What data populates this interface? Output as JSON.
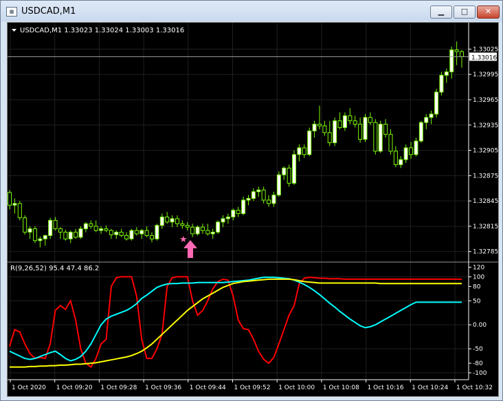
{
  "window": {
    "title": "USDCAD,M1",
    "icon": "chart-window-icon",
    "buttons": [
      "minimize",
      "maximize",
      "close"
    ]
  },
  "chart_header": {
    "symbol_info": "USDCAD,M1  1.33023 1.33024 1.33003 1.33016"
  },
  "price_axis": {
    "ticks": [
      "1.33025",
      "1.32995",
      "1.32965",
      "1.32935",
      "1.32905",
      "1.32875",
      "1.32845",
      "1.32815",
      "1.32785"
    ],
    "current_price": "1.33016"
  },
  "indicator": {
    "label": "R(9,26,52) 95.4 47.4 86.2",
    "axis_ticks": [
      "120",
      "100",
      "80",
      "50",
      "0.00",
      "-50",
      "-80",
      "-100"
    ]
  },
  "time_axis": {
    "ticks": [
      "1 Oct 2020",
      "1 Oct 09:20",
      "1 Oct 09:28",
      "1 Oct 09:36",
      "1 Oct 09:44",
      "1 Oct 09:52",
      "1 Oct 10:00",
      "1 Oct 10:08",
      "1 Oct 10:16",
      "1 Oct 10:24",
      "1 Oct 10:32"
    ]
  },
  "colors": {
    "background": "#000000",
    "candle_bull": "#ffffff",
    "candle_bear": "#000000",
    "candle_border": "#7cfc00",
    "bid_line": "#a0a0a0",
    "fast_line": "#ff0000",
    "medium_line": "#00ffff",
    "slow_line": "#ffff00",
    "arrow": "#ff69b4"
  },
  "chart_data": [
    {
      "type": "candlestick",
      "title": "USDCAD,M1",
      "ylim": [
        1.32775,
        1.3304
      ],
      "candles": [
        [
          1.32855,
          1.32858,
          1.32835,
          1.3284
        ],
        [
          1.3284,
          1.32848,
          1.3283,
          1.32842
        ],
        [
          1.32842,
          1.32845,
          1.32822,
          1.32825
        ],
        [
          1.32825,
          1.32828,
          1.32805,
          1.32808
        ],
        [
          1.32808,
          1.32815,
          1.328,
          1.32812
        ],
        [
          1.32812,
          1.32815,
          1.32795,
          1.32798
        ],
        [
          1.32798,
          1.32803,
          1.3279,
          1.328
        ],
        [
          1.328,
          1.32805,
          1.32792,
          1.32804
        ],
        [
          1.32804,
          1.32825,
          1.328,
          1.32822
        ],
        [
          1.32822,
          1.32826,
          1.3281,
          1.32812
        ],
        [
          1.32812,
          1.32814,
          1.328,
          1.32808
        ],
        [
          1.32808,
          1.32811,
          1.32798,
          1.328
        ],
        [
          1.328,
          1.3281,
          1.32795,
          1.32808
        ],
        [
          1.32808,
          1.32812,
          1.328,
          1.32802
        ],
        [
          1.32802,
          1.32815,
          1.328,
          1.32812
        ],
        [
          1.32812,
          1.3282,
          1.32808,
          1.32818
        ],
        [
          1.32818,
          1.32822,
          1.32812,
          1.32815
        ],
        [
          1.32815,
          1.32822,
          1.32808,
          1.3281
        ],
        [
          1.3281,
          1.32815,
          1.32806,
          1.32812
        ],
        [
          1.32812,
          1.32816,
          1.32808,
          1.3281
        ],
        [
          1.3281,
          1.32812,
          1.328,
          1.32805
        ],
        [
          1.32805,
          1.3281,
          1.328,
          1.32808
        ],
        [
          1.32808,
          1.32812,
          1.32802,
          1.32804
        ],
        [
          1.32804,
          1.32808,
          1.32798,
          1.328
        ],
        [
          1.328,
          1.32812,
          1.32798,
          1.3281
        ],
        [
          1.3281,
          1.32814,
          1.32804,
          1.32806
        ],
        [
          1.32806,
          1.32812,
          1.328,
          1.3281
        ],
        [
          1.3281,
          1.32815,
          1.32802,
          1.32804
        ],
        [
          1.32804,
          1.32808,
          1.32796,
          1.328
        ],
        [
          1.328,
          1.32818,
          1.32798,
          1.32816
        ],
        [
          1.32816,
          1.3283,
          1.32812,
          1.32826
        ],
        [
          1.32826,
          1.32832,
          1.32818,
          1.3282
        ],
        [
          1.3282,
          1.32828,
          1.32814,
          1.32824
        ],
        [
          1.32824,
          1.32828,
          1.32814,
          1.32818
        ],
        [
          1.32818,
          1.32822,
          1.32812,
          1.32816
        ],
        [
          1.32816,
          1.3282,
          1.3281,
          1.32814
        ],
        [
          1.32814,
          1.32818,
          1.32802,
          1.32806
        ],
        [
          1.32806,
          1.32816,
          1.32804,
          1.32814
        ],
        [
          1.32814,
          1.32818,
          1.32806,
          1.3281
        ],
        [
          1.3281,
          1.32818,
          1.32804,
          1.32806
        ],
        [
          1.32806,
          1.32812,
          1.328,
          1.32808
        ],
        [
          1.32808,
          1.32822,
          1.32806,
          1.3282
        ],
        [
          1.3282,
          1.32828,
          1.32814,
          1.32824
        ],
        [
          1.32824,
          1.3283,
          1.32818,
          1.32826
        ],
        [
          1.32826,
          1.32836,
          1.32822,
          1.32834
        ],
        [
          1.32834,
          1.32838,
          1.32826,
          1.3283
        ],
        [
          1.3283,
          1.3285,
          1.32828,
          1.32846
        ],
        [
          1.32846,
          1.32852,
          1.3284,
          1.32848
        ],
        [
          1.32848,
          1.3286,
          1.32845,
          1.32856
        ],
        [
          1.32856,
          1.32862,
          1.3285,
          1.32858
        ],
        [
          1.32858,
          1.32862,
          1.32842,
          1.32846
        ],
        [
          1.32846,
          1.32852,
          1.32838,
          1.32842
        ],
        [
          1.32842,
          1.32856,
          1.32838,
          1.32852
        ],
        [
          1.32852,
          1.3288,
          1.3285,
          1.32876
        ],
        [
          1.32876,
          1.32886,
          1.3287,
          1.32884
        ],
        [
          1.32884,
          1.32888,
          1.32862,
          1.32866
        ],
        [
          1.32866,
          1.32905,
          1.32864,
          1.329
        ],
        [
          1.329,
          1.32912,
          1.32892,
          1.32908
        ],
        [
          1.32908,
          1.32912,
          1.32896,
          1.329
        ],
        [
          1.329,
          1.32932,
          1.32898,
          1.32928
        ],
        [
          1.32928,
          1.3294,
          1.3292,
          1.32936
        ],
        [
          1.32936,
          1.32958,
          1.3293,
          1.32934
        ],
        [
          1.32934,
          1.3294,
          1.32922,
          1.32926
        ],
        [
          1.32926,
          1.3294,
          1.3291,
          1.32914
        ],
        [
          1.32914,
          1.32944,
          1.3291,
          1.3294
        ],
        [
          1.3294,
          1.3295,
          1.3293,
          1.32932
        ],
        [
          1.32932,
          1.3295,
          1.32928,
          1.32946
        ],
        [
          1.32946,
          1.32955,
          1.32936,
          1.3294
        ],
        [
          1.3294,
          1.32946,
          1.32932,
          1.32936
        ],
        [
          1.32936,
          1.32944,
          1.32914,
          1.32918
        ],
        [
          1.32918,
          1.32948,
          1.32915,
          1.32944
        ],
        [
          1.32944,
          1.3295,
          1.32935,
          1.32938
        ],
        [
          1.32938,
          1.32942,
          1.329,
          1.32904
        ],
        [
          1.32904,
          1.3294,
          1.32902,
          1.32936
        ],
        [
          1.32936,
          1.32942,
          1.3292,
          1.32924
        ],
        [
          1.32924,
          1.3293,
          1.329,
          1.32904
        ],
        [
          1.32904,
          1.3291,
          1.32885,
          1.32888
        ],
        [
          1.32888,
          1.32898,
          1.32884,
          1.32894
        ],
        [
          1.32894,
          1.32912,
          1.3289,
          1.32908
        ],
        [
          1.32908,
          1.32915,
          1.32895,
          1.329
        ],
        [
          1.329,
          1.3292,
          1.32898,
          1.32916
        ],
        [
          1.32916,
          1.3294,
          1.32914,
          1.32938
        ],
        [
          1.32938,
          1.32948,
          1.3293,
          1.32944
        ],
        [
          1.32944,
          1.32952,
          1.32936,
          1.32948
        ],
        [
          1.32948,
          1.32978,
          1.32944,
          1.32974
        ],
        [
          1.32974,
          1.32998,
          1.3297,
          1.32994
        ],
        [
          1.32994,
          1.33002,
          1.32985,
          1.32998
        ],
        [
          1.32998,
          1.33028,
          1.3299,
          1.33024
        ],
        [
          1.33024,
          1.33034,
          1.33006,
          1.33022
        ],
        [
          1.33022,
          1.33024,
          1.33003,
          1.33016
        ]
      ],
      "bid": 1.33016
    },
    {
      "type": "line",
      "title": "R(9,26,52) 95.4 47.4 86.2",
      "ylim": [
        -110,
        125
      ],
      "series": [
        {
          "color": "#ff0000",
          "values": [
            -45,
            -10,
            -15,
            -40,
            -60,
            -70,
            -68,
            -70,
            -40,
            30,
            40,
            32,
            50,
            10,
            -50,
            -80,
            -88,
            -70,
            -40,
            -30,
            80,
            98,
            100,
            100,
            100,
            60,
            -30,
            -70,
            -70,
            -50,
            -20,
            80,
            98,
            100,
            100,
            100,
            50,
            20,
            30,
            50,
            75,
            90,
            95,
            93,
            60,
            10,
            -8,
            -10,
            -30,
            -55,
            -72,
            -80,
            -68,
            -40,
            -10,
            20,
            40,
            85,
            97,
            99,
            98,
            97,
            97,
            96,
            96,
            96,
            95,
            95,
            95,
            95,
            95,
            95,
            95,
            95,
            95,
            95,
            95,
            95,
            95,
            95,
            95,
            95,
            95,
            95,
            95,
            95,
            95,
            95,
            95,
            95
          ]
        },
        {
          "color": "#00ffff",
          "values": [
            -55,
            -60,
            -65,
            -70,
            -72,
            -70,
            -66,
            -62,
            -58,
            -55,
            -62,
            -70,
            -75,
            -72,
            -66,
            -55,
            -40,
            -20,
            0,
            12,
            18,
            22,
            26,
            30,
            36,
            44,
            55,
            62,
            70,
            78,
            82,
            85,
            86,
            86,
            87,
            87,
            87,
            88,
            88,
            88,
            88,
            88,
            88,
            89,
            90,
            91,
            92,
            93,
            95,
            97,
            99,
            99,
            99,
            98,
            97,
            96,
            93,
            89,
            84,
            78,
            71,
            63,
            54,
            45,
            37,
            28,
            20,
            12,
            5,
            -2,
            -6,
            -4,
            0,
            6,
            12,
            18,
            24,
            30,
            36,
            42,
            47,
            47,
            47,
            47,
            47,
            47,
            47,
            47,
            47,
            47
          ]
        },
        {
          "color": "#ffff00",
          "values": [
            -88,
            -88,
            -88,
            -88,
            -87,
            -87,
            -86,
            -86,
            -85,
            -85,
            -84,
            -84,
            -83,
            -82,
            -82,
            -81,
            -80,
            -79,
            -77,
            -75,
            -73,
            -71,
            -69,
            -67,
            -64,
            -60,
            -55,
            -48,
            -40,
            -30,
            -20,
            -10,
            0,
            10,
            20,
            30,
            38,
            46,
            54,
            60,
            66,
            72,
            78,
            82,
            86,
            88,
            90,
            91,
            92,
            93,
            94,
            95,
            95,
            95,
            95,
            95,
            94,
            92,
            90,
            89,
            88,
            87,
            87,
            87,
            87,
            87,
            87,
            87,
            87,
            87,
            87,
            87,
            87,
            86,
            86,
            86,
            86,
            86,
            86,
            86,
            86,
            86,
            86,
            86,
            86,
            86,
            86,
            86,
            86,
            86
          ]
        }
      ]
    }
  ]
}
